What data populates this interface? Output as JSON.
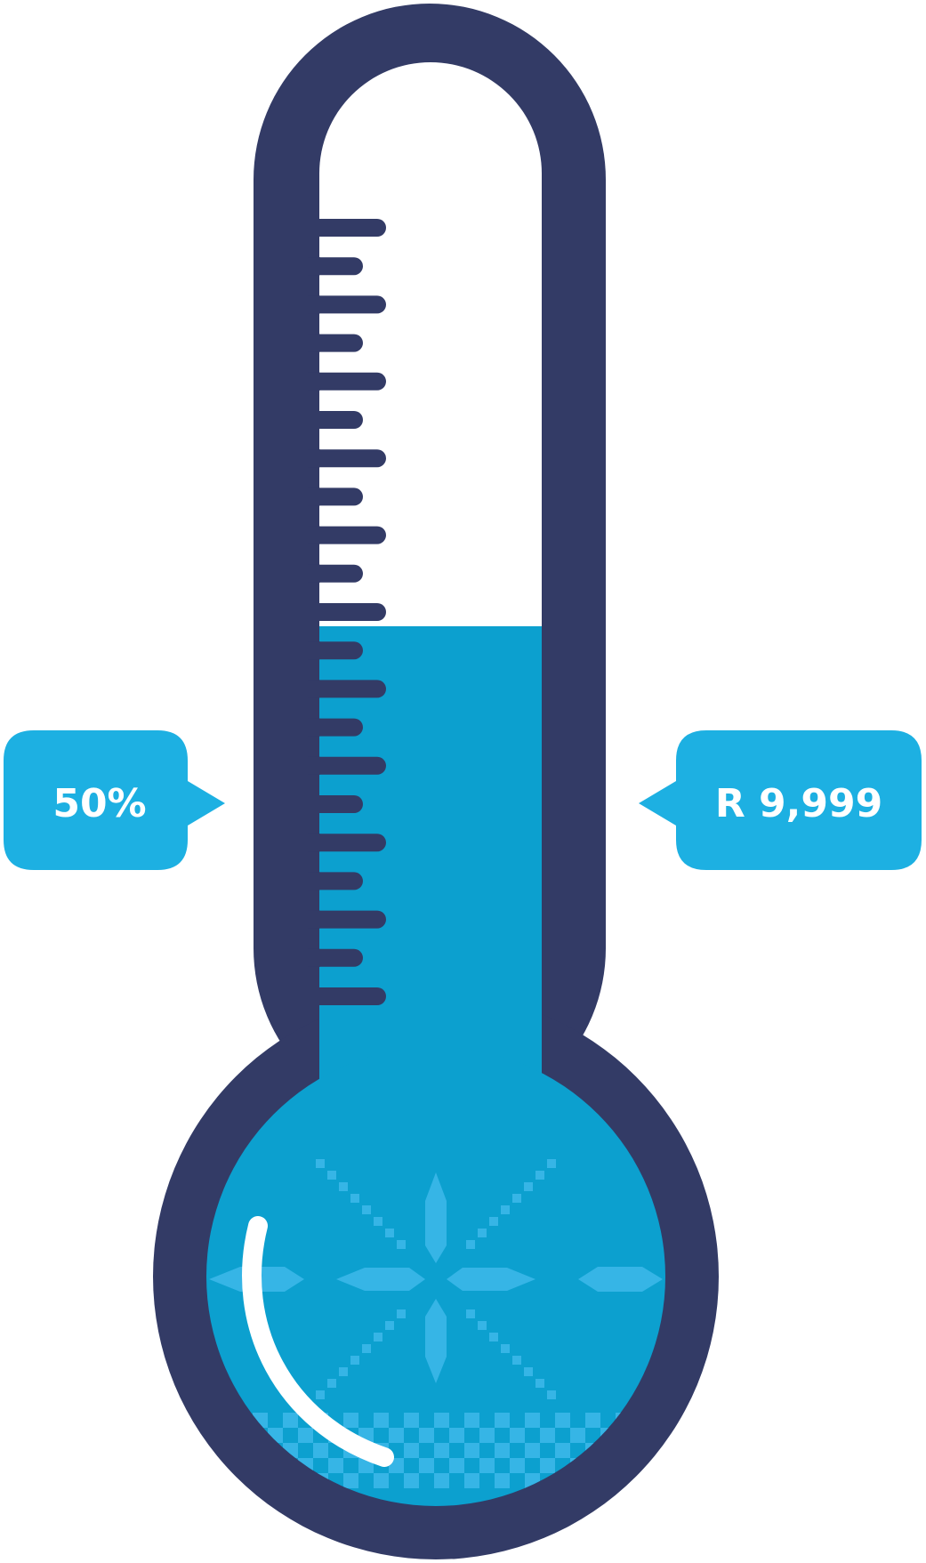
{
  "thermometer": {
    "progress_percent": 50,
    "fill_fraction": 0.5,
    "colors": {
      "outline": "#333b66",
      "mercury": "#0ca0cf",
      "callout": "#1db0e2",
      "pattern": "#36b5e6",
      "highlight": "#ffffff",
      "background": "#ffffff"
    }
  },
  "left_callout": {
    "text": "50%"
  },
  "right_callout": {
    "text": "R 9,999"
  }
}
